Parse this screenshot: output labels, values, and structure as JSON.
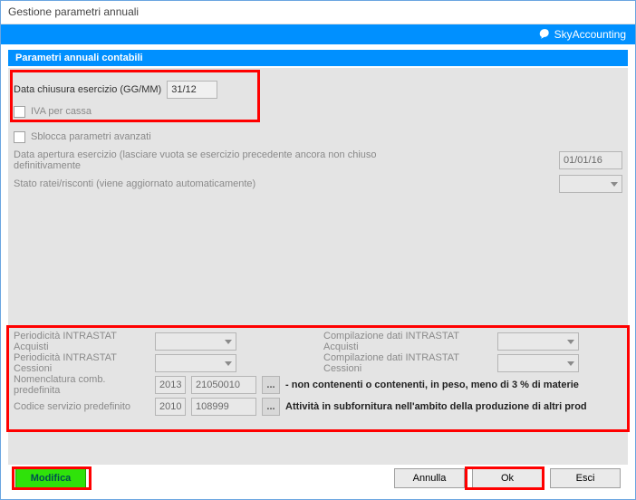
{
  "window": {
    "title": "Gestione parametri annuali"
  },
  "brand": {
    "label": "SkyAccounting"
  },
  "section": {
    "title": "Parametri annuali contabili"
  },
  "fields": {
    "data_chiusura_label": "Data chiusura esercizio (GG/MM)",
    "data_chiusura_value": "31/12",
    "iva_per_cassa_label": "IVA per cassa",
    "sblocca_label": "Sblocca parametri avanzati",
    "data_apertura_label": "Data apertura esercizio (lasciare vuota se esercizio precedente ancora non chiuso definitivamente",
    "data_apertura_value": "01/01/16",
    "stato_ratei_label": "Stato ratei/risconti (viene aggiornato automaticamente)",
    "period_intrastat_acq_label": "Periodicità INTRASTAT Acquisti",
    "period_intrastat_ces_label": "Periodicità INTRASTAT Cessioni",
    "comp_intrastat_acq_label": "Compilazione dati INTRASTAT Acquisti",
    "comp_intrastat_ces_label": "Compilazione dati INTRASTAT Cessioni",
    "nomenclatura_label": "Nomenclatura comb. predefinita",
    "nomenclatura_year": "2013",
    "nomenclatura_code": "21050010",
    "nomenclatura_desc": "- non contenenti o contenenti, in peso, meno di 3 % di materie",
    "codice_servizio_label": "Codice servizio predefinito",
    "codice_servizio_year": "2010",
    "codice_servizio_code": "108999",
    "codice_servizio_desc": "Attività in subfornitura nell'ambito della produzione di altri prod",
    "ellipsis": "..."
  },
  "buttons": {
    "modifica": "Modifica",
    "annulla": "Annulla",
    "ok": "Ok",
    "esci": "Esci"
  }
}
